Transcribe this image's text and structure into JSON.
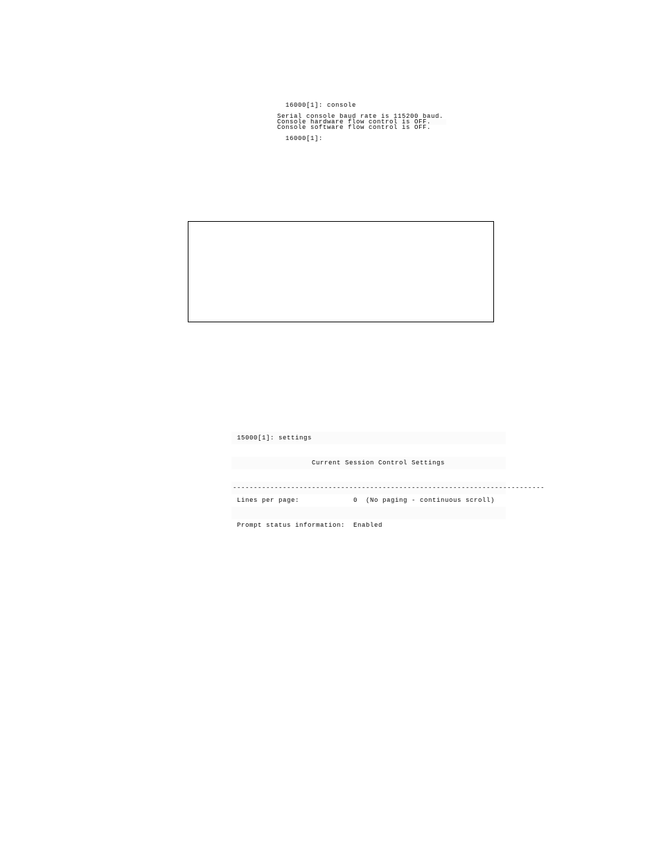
{
  "term1": {
    "prompt1": "  16000[1]: console",
    "baud": "Serial console baud rate is 115200 baud.",
    "hwflow": "Console hardware flow control is OFF.",
    "swflow": "Console software flow control is OFF.",
    "prompt2": "  16000[1]: "
  },
  "term2": {
    "prompt": " 15000[1]: settings",
    "title": "                   Current Session Control Settings",
    "dash": "---------------------------------------------------------------------------",
    "lines": " Lines per page:             0  (No paging - continuous scroll)",
    "promptst": " Prompt status information:  Enabled"
  }
}
